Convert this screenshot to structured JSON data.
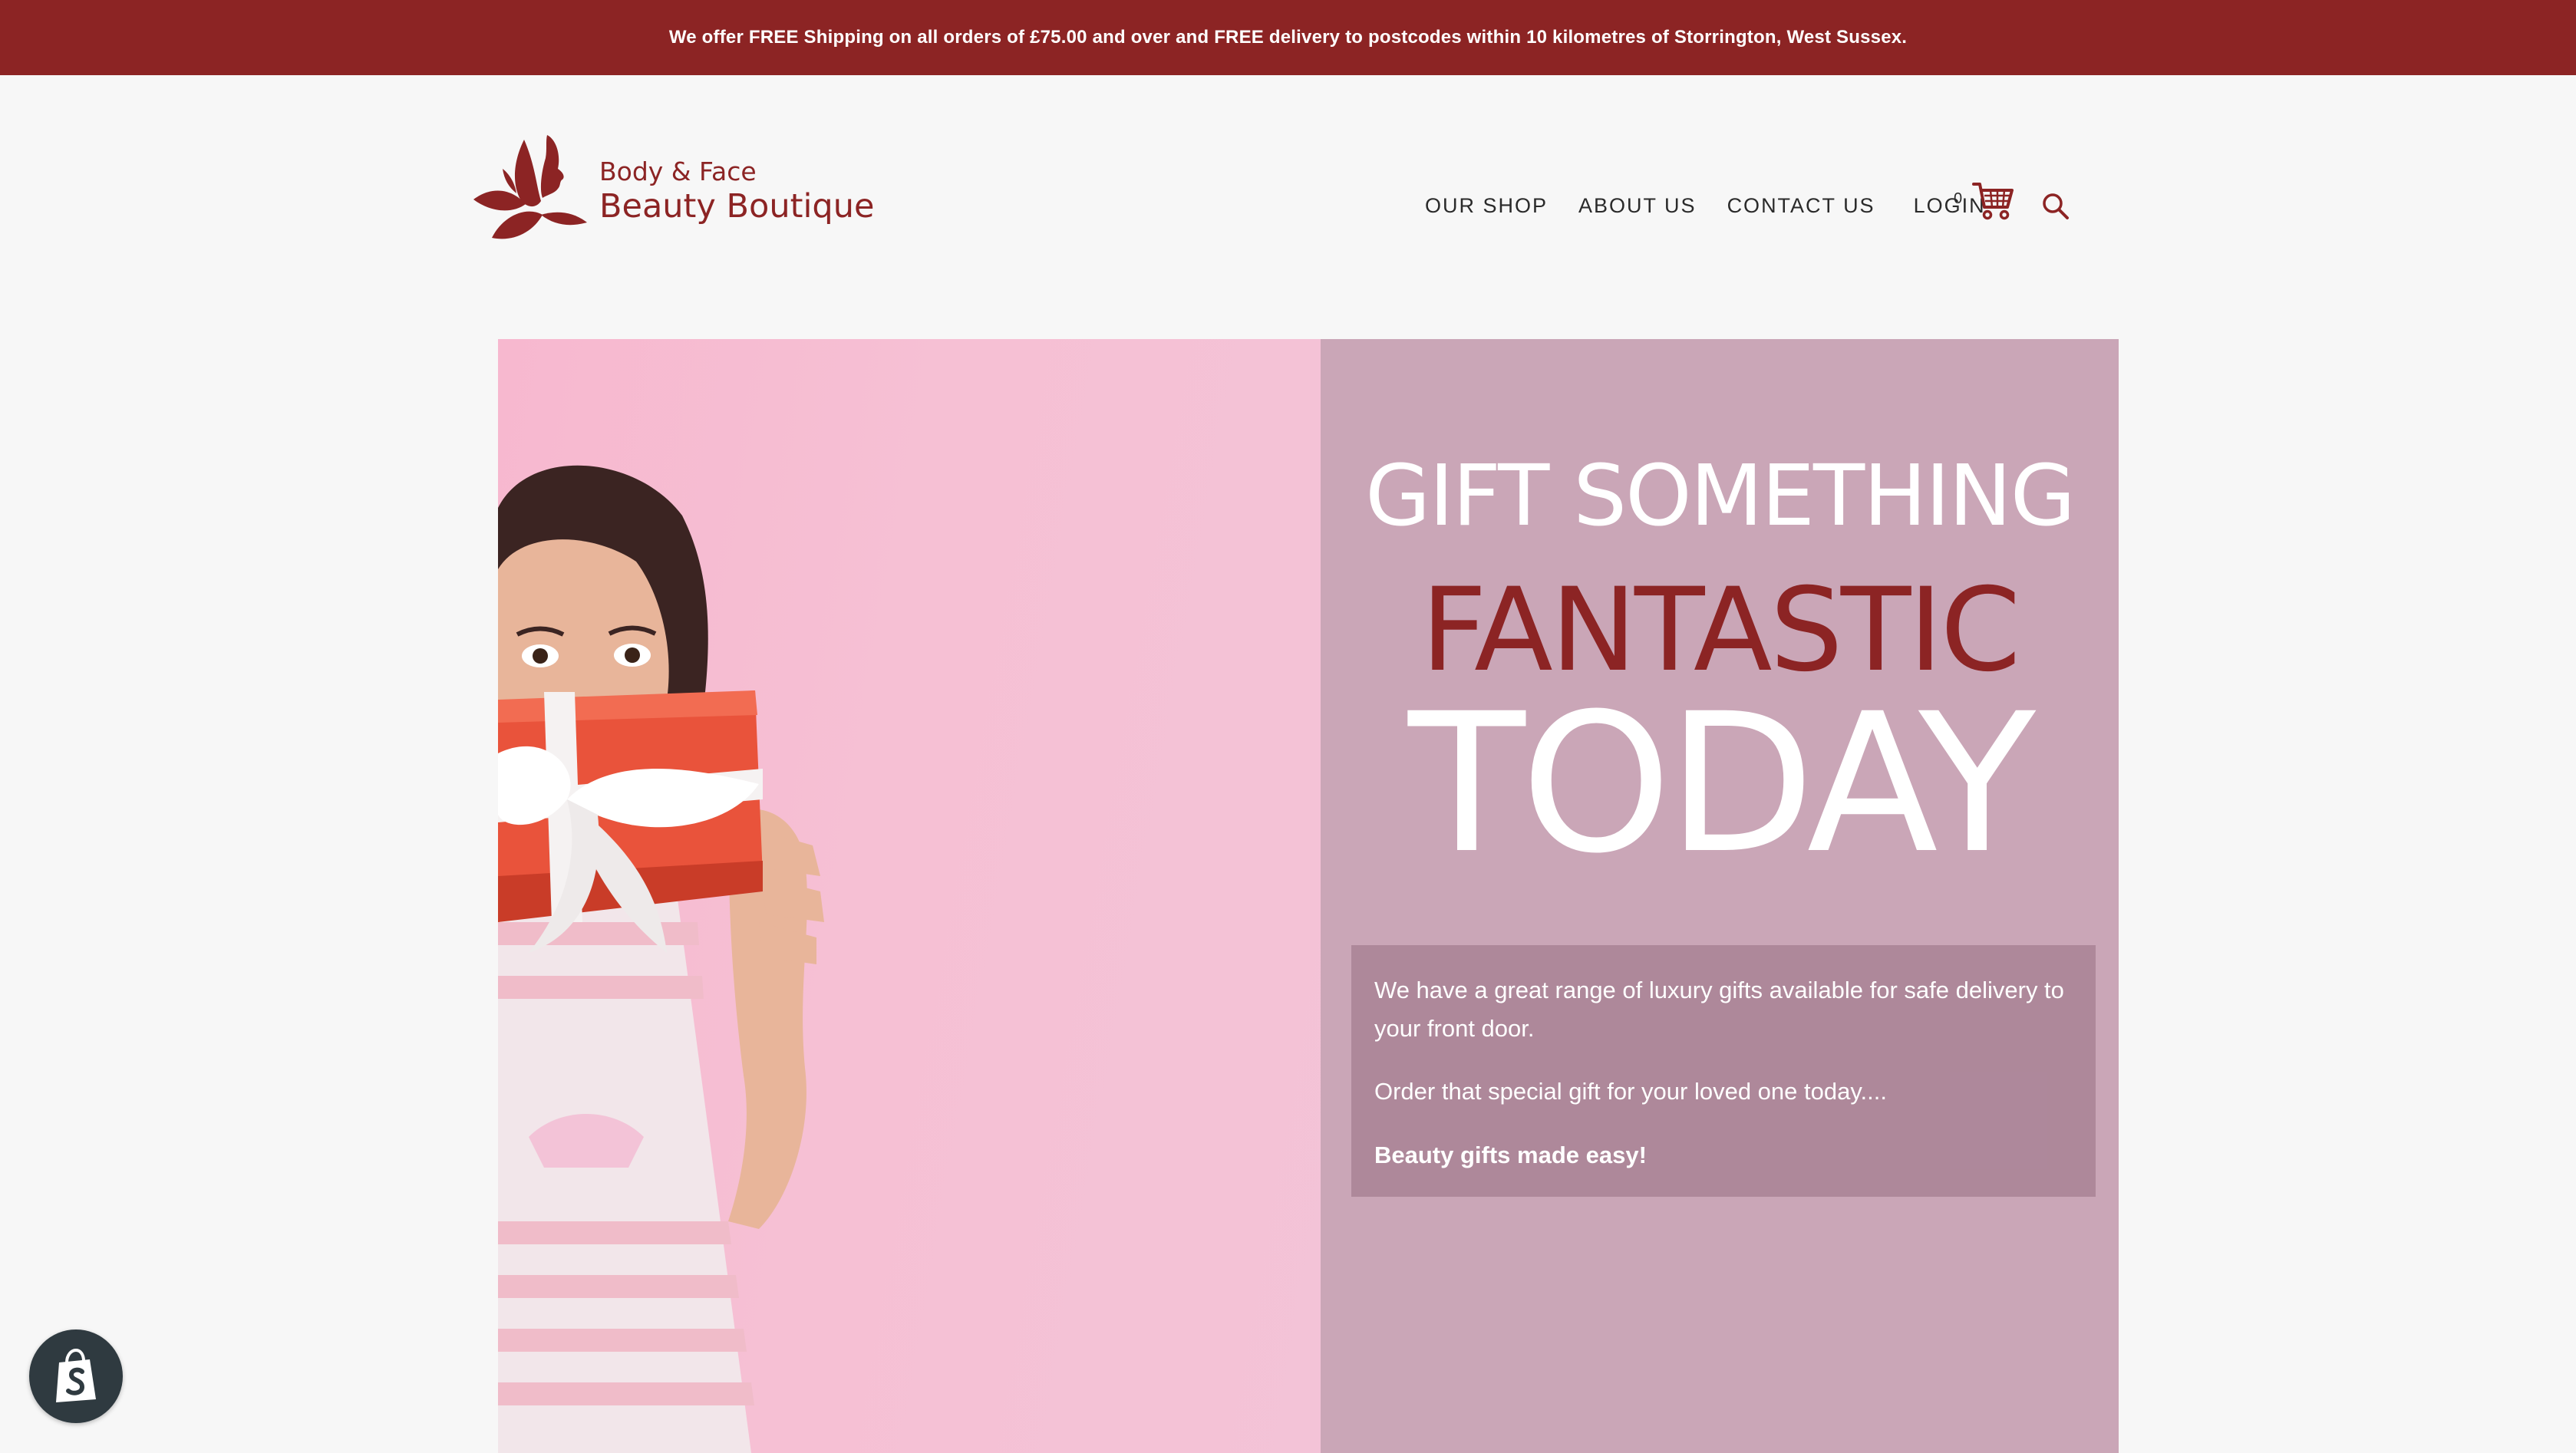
{
  "announcement": {
    "text": "We offer FREE Shipping on all orders of £75.00 and over and FREE delivery to postcodes within 10 kilometres of Storrington, West Sussex."
  },
  "logo": {
    "line1": "Body & Face",
    "line2": "Beauty Boutique"
  },
  "nav": {
    "items": [
      {
        "label": "OUR SHOP"
      },
      {
        "label": "ABOUT US"
      },
      {
        "label": "CONTACT US"
      },
      {
        "label": "LOGIN"
      }
    ],
    "cart_count": "0",
    "icons": [
      "cart-icon",
      "search-icon"
    ]
  },
  "hero": {
    "headline_1": "GIFT SOMETHING",
    "headline_2": "FANTASTIC",
    "headline_3": "TODAY",
    "para_1": "We have a great range of luxury gifts available for safe delivery to your front door.",
    "para_2": "Order that special gift for your loved one today....",
    "para_3": "Beauty gifts made easy!"
  },
  "colors": {
    "brand": "#8c2424",
    "hero_panel": "#caa6b7",
    "hero_pink": "#f6c0d4",
    "info_box": "#a27f92"
  },
  "badge": {
    "icon": "shopify-bag-icon"
  }
}
